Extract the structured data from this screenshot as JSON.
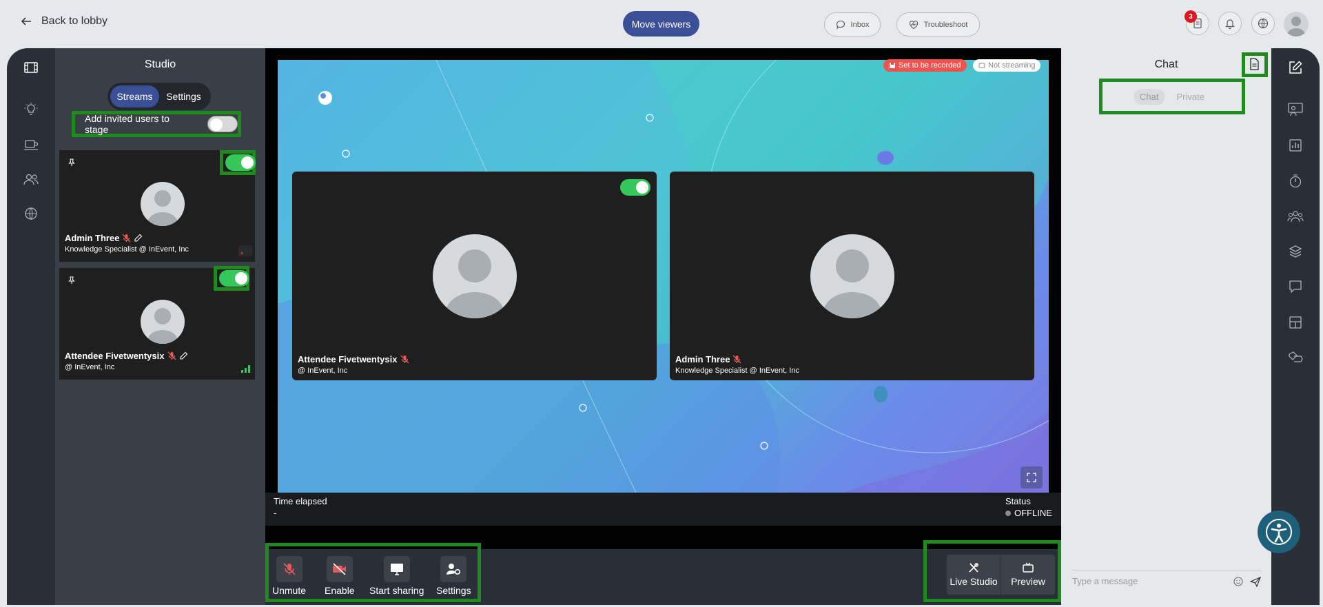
{
  "topbar": {
    "back_label": "Back to lobby",
    "move_viewers": "Move viewers",
    "inbox": "Inbox",
    "troubleshoot": "Troubleshoot",
    "notif_count": "3"
  },
  "studio": {
    "title": "Studio",
    "tabs": [
      "Streams",
      "Settings"
    ],
    "add_invited_label": "Add invited users to stage",
    "cards": [
      {
        "name": "Admin Three",
        "subtitle": "Knowledge Specialist @ InEvent, Inc",
        "on_stage": true
      },
      {
        "name": "Attendee Fivetwentysix",
        "subtitle": "@ InEvent, Inc",
        "on_stage": true
      }
    ]
  },
  "stage": {
    "recorded": "Set to be recorded",
    "streaming": "Not streaming",
    "tiles": [
      {
        "name": "Attendee Fivetwentysix",
        "subtitle": "@ InEvent, Inc"
      },
      {
        "name": "Admin Three",
        "subtitle": "Knowledge Specialist @ InEvent, Inc"
      }
    ],
    "time_elapsed_label": "Time elapsed",
    "time_elapsed_value": "-",
    "status_label": "Status",
    "status_value": "OFFLINE"
  },
  "controls": {
    "unmute": "Unmute",
    "enable": "Enable",
    "start_sharing": "Start sharing",
    "settings": "Settings",
    "live_studio": "Live Studio",
    "preview": "Preview"
  },
  "chat": {
    "title": "Chat",
    "tabs": [
      "Chat",
      "Private"
    ],
    "placeholder": "Type a message"
  },
  "colors": {
    "accent": "#3b4f96",
    "toggle_on": "#35c759",
    "record": "#ef5350",
    "highlight": "#1f8b1f"
  }
}
